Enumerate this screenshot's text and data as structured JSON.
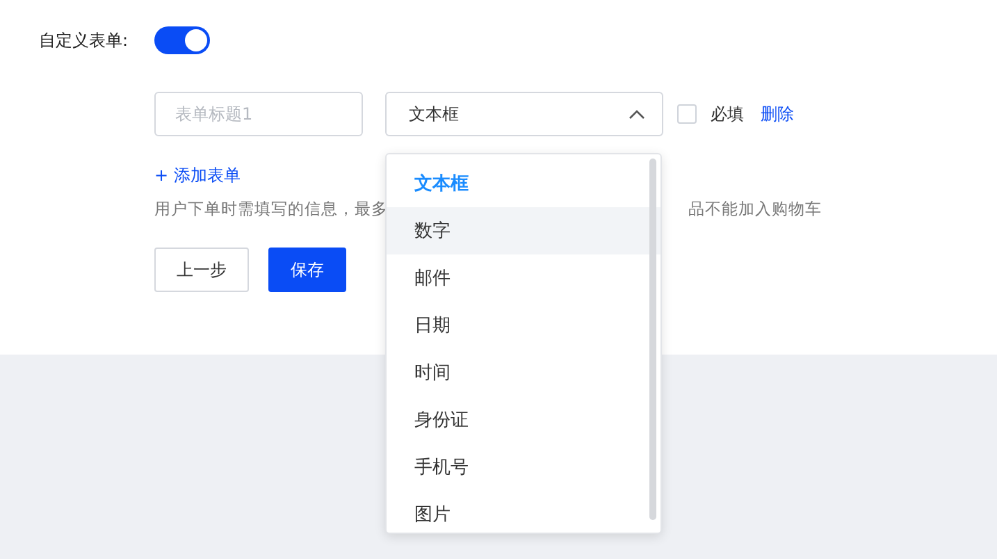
{
  "custom_form": {
    "label": "自定义表单:",
    "on": true
  },
  "fields": [
    {
      "title_placeholder": "表单标题1",
      "type_value": "文本框",
      "expanded": true,
      "required": false,
      "delete": "删除",
      "required_label": "必填"
    }
  ],
  "add_link": "+ 添加表单",
  "hint_parts": [
    "用户下单时需填写的信息，最多",
    "品不能加入购物车"
  ],
  "buttons": [
    {
      "label": "上一步",
      "kind": "secondary"
    },
    {
      "label": "保存",
      "kind": "primary"
    }
  ],
  "dropdown": {
    "options": [
      {
        "label": "文本框",
        "selected": true,
        "hovered": false
      },
      {
        "label": "数字",
        "selected": false,
        "hovered": true
      },
      {
        "label": "邮件",
        "selected": false,
        "hovered": false
      },
      {
        "label": "日期",
        "selected": false,
        "hovered": false
      },
      {
        "label": "时间",
        "selected": false,
        "hovered": false
      },
      {
        "label": "身份证",
        "selected": false,
        "hovered": false
      },
      {
        "label": "手机号",
        "selected": false,
        "hovered": false
      },
      {
        "label": "图片",
        "selected": false,
        "hovered": false
      }
    ]
  }
}
